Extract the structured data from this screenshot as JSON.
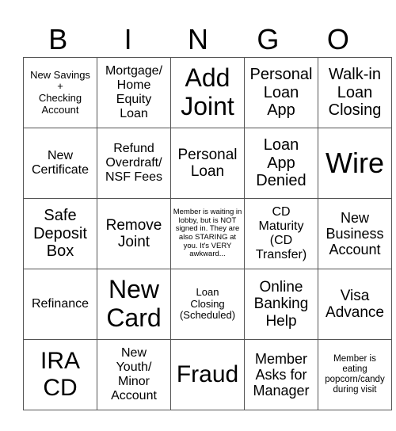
{
  "header": {
    "letters": [
      "B",
      "I",
      "N",
      "G",
      "O"
    ]
  },
  "rows": [
    [
      "New Savings\n+\nChecking\nAccount",
      "Mortgage/\nHome\nEquity\nLoan",
      "Add\nJoint",
      "Personal\nLoan\nApp",
      "Walk-in\nLoan\nClosing"
    ],
    [
      "New\nCertificate",
      "Refund\nOverdraft/\nNSF Fees",
      "Personal\nLoan",
      "Loan\nApp\nDenied",
      "Wire"
    ],
    [
      "Safe\nDeposit\nBox",
      "Remove\nJoint",
      "Member is waiting in lobby, but is NOT signed in. They are also STARING at you. It's VERY awkward...",
      "CD\nMaturity\n(CD\nTransfer)",
      "New\nBusiness\nAccount"
    ],
    [
      "Refinance",
      "New\nCard",
      "Loan\nClosing\n(Scheduled)",
      "Online\nBanking\nHelp",
      "Visa\nAdvance"
    ],
    [
      "IRA\nCD",
      "New\nYouth/\nMinor\nAccount",
      "Fraud",
      "Member\nAsks for\nManager",
      "Member is\neating\npopcorn/candy\nduring visit"
    ]
  ]
}
